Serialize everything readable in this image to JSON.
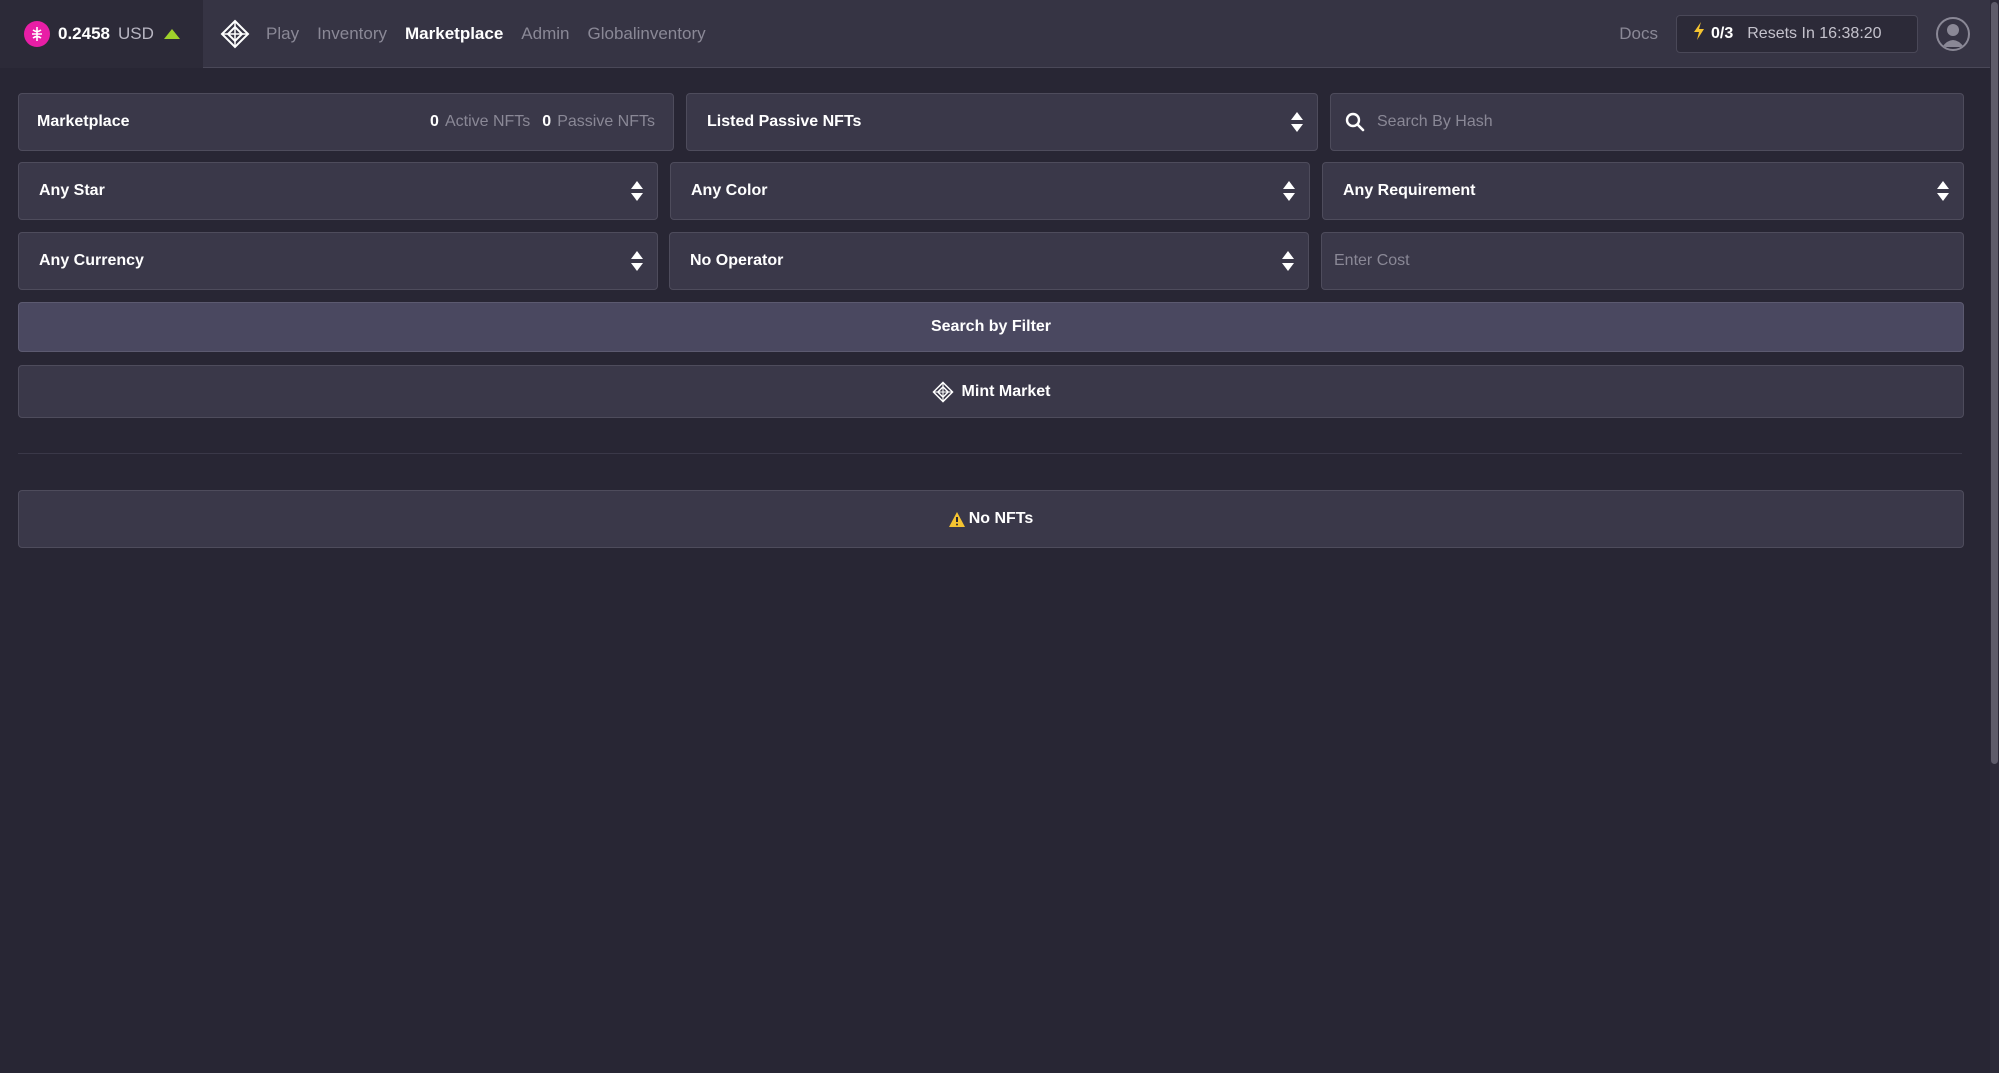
{
  "header": {
    "price_value": "0.2458",
    "price_unit": "USD",
    "nav": [
      "Play",
      "Inventory",
      "Marketplace",
      "Admin",
      "Globalinventory"
    ],
    "active_nav": "Marketplace",
    "docs_label": "Docs",
    "energy_count": "0/3",
    "resets_label": "Resets In 16:38:20"
  },
  "marketplace": {
    "title": "Marketplace",
    "active_count": "0",
    "active_label": "Active NFTs",
    "passive_count": "0",
    "passive_label": "Passive NFTs"
  },
  "listing_select": {
    "value": "Listed Passive NFTs"
  },
  "search": {
    "placeholder": "Search By Hash"
  },
  "filters": {
    "star": "Any Star",
    "color": "Any Color",
    "requirement": "Any Requirement",
    "currency": "Any Currency",
    "operator": "No Operator",
    "cost_placeholder": "Enter Cost"
  },
  "buttons": {
    "search_filter": "Search by Filter",
    "mint_market": "Mint Market"
  },
  "empty_state": {
    "label": "No NFTs"
  },
  "colors": {
    "background": "#282634",
    "panel": "#3a3849",
    "coin": "#e81ea6",
    "up": "#9fd12b",
    "energy": "#f5c431",
    "warning": "#f5c431"
  },
  "icons": [
    "coin-icon",
    "price-up-icon",
    "logo-icon",
    "lightning-icon",
    "avatar-icon",
    "search-icon",
    "select-arrows-icon",
    "mint-logo-icon",
    "warning-icon"
  ]
}
